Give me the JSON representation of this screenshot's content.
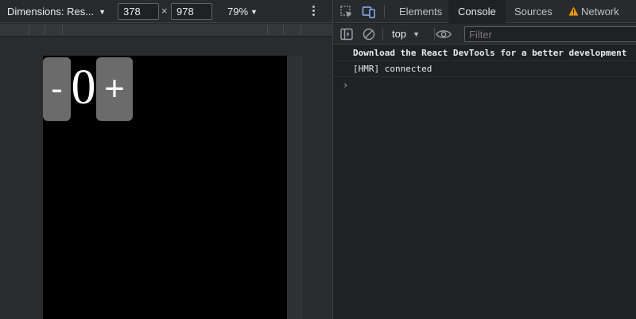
{
  "device_toolbar": {
    "dimensions_label": "Dimensions: Res...",
    "width_value": "378",
    "times_symbol": "×",
    "height_value": "978",
    "zoom_label": "79%"
  },
  "app": {
    "minus_label": "-",
    "count": "0",
    "plus_label": "+"
  },
  "devtools": {
    "tabs": [
      {
        "label": "Elements"
      },
      {
        "label": "Console"
      },
      {
        "label": "Sources"
      },
      {
        "label": "Network"
      }
    ],
    "active_tab": "Console",
    "network_warning_icon": "warning-icon",
    "context_label": "top",
    "filter_placeholder": "Filter",
    "messages": [
      {
        "text": "Download the React DevTools for a better development"
      },
      {
        "text": "[HMR] connected"
      }
    ],
    "prompt_symbol": "›"
  },
  "colors": {
    "accent": "#8ab4f8",
    "warning": "#f29900",
    "app_button": "#6b6b6b"
  }
}
